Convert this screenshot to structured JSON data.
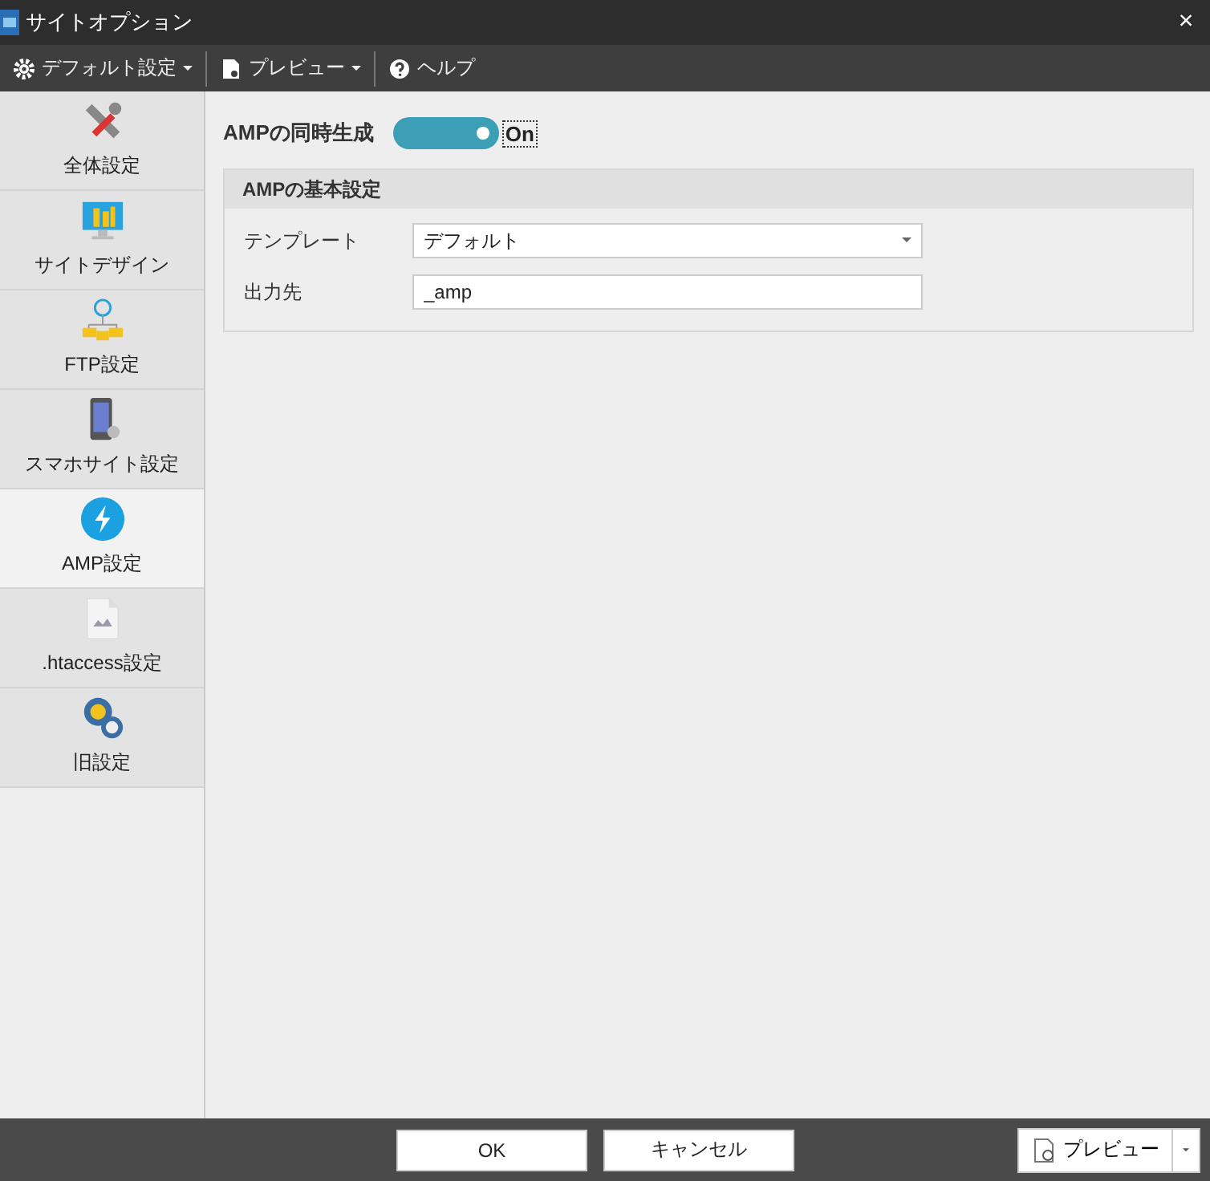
{
  "window": {
    "title": "サイトオプション",
    "close": "×"
  },
  "toolbar": [
    {
      "label": "デフォルト設定",
      "kind": "dropdown"
    },
    {
      "label": "プレビュー",
      "kind": "dropdown"
    },
    {
      "label": "ヘルプ",
      "kind": "button"
    }
  ],
  "sidebar": {
    "items": [
      {
        "label": "全体設定",
        "selected": false
      },
      {
        "label": "サイトデザイン",
        "selected": false
      },
      {
        "label": "FTP設定",
        "selected": false
      },
      {
        "label": "スマホサイト設定",
        "selected": false
      },
      {
        "label": "AMP設定",
        "selected": true
      },
      {
        "label": ".htaccess設定",
        "selected": false
      },
      {
        "label": "旧設定",
        "selected": false
      }
    ]
  },
  "toggle": {
    "label": "AMPの同時生成",
    "on": true,
    "state_text": "On"
  },
  "group": {
    "title": "AMPの基本設定",
    "fields": [
      {
        "label": "テンプレート",
        "kind": "select",
        "value": "デフォルト"
      },
      {
        "label": "出力先",
        "kind": "text",
        "value": "_amp"
      }
    ]
  },
  "footer": {
    "buttons": [
      "OK",
      "キャンセル"
    ],
    "preview": "プレビュー"
  }
}
